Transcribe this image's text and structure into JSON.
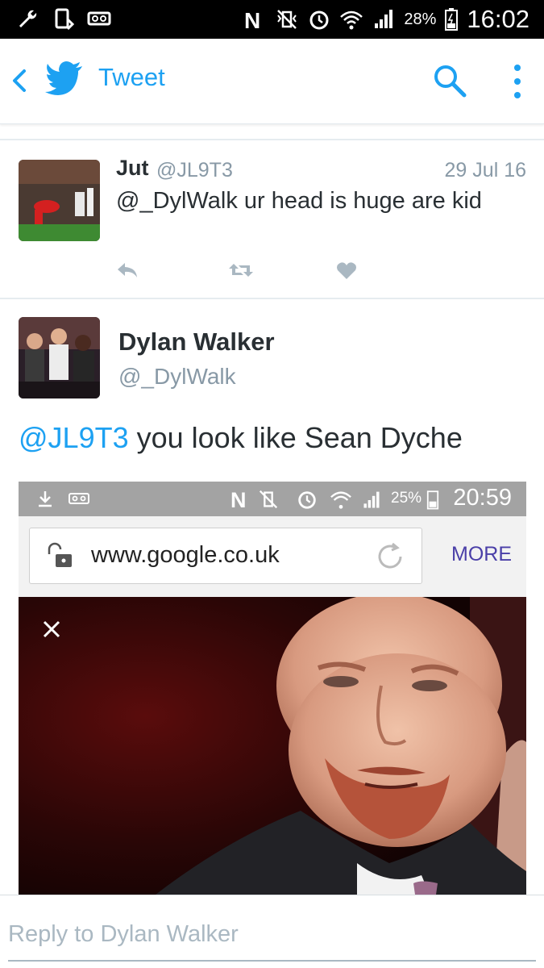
{
  "status_bar": {
    "battery_percent": "28%",
    "time": "16:02"
  },
  "app_bar": {
    "title": "Tweet"
  },
  "tweets": [
    {
      "name": "Jut",
      "handle": "@JL9T3",
      "date": "29 Jul 16",
      "text": "@_DylWalk ur head is huge are kid"
    },
    {
      "name": "Dylan Walker",
      "handle": "@_DylWalk",
      "mention": "@JL9T3",
      "text": " you look like Sean Dyche"
    }
  ],
  "embedded_screenshot": {
    "battery_percent": "25%",
    "time": "20:59",
    "url": "www.google.co.uk",
    "more_label": "MORE"
  },
  "reply": {
    "placeholder": "Reply to Dylan Walker"
  },
  "colors": {
    "twitter_blue": "#1da1f2",
    "secondary_text": "#8899a6",
    "primary_text": "#292f33",
    "status_bar": "#000000"
  }
}
